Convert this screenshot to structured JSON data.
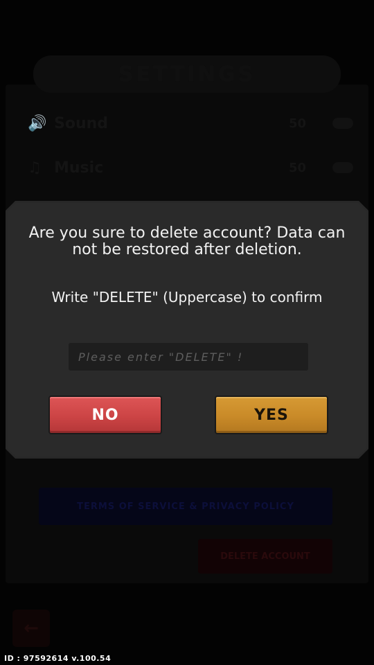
{
  "background": {
    "title": "SETTINGS",
    "rows": [
      {
        "icon": "speaker-icon",
        "label": "Sound",
        "value": "50"
      },
      {
        "icon": "music-note-icon",
        "label": "Music",
        "value": "50"
      }
    ],
    "terms_label": "TERMS OF SERVICE & PRIVACY POLICY",
    "delete_label": "DELETE ACCOUNT"
  },
  "dialog": {
    "message": "Are you sure to delete account? Data can not be restored after deletion.",
    "instruction": "Write \"DELETE\" (Uppercase) to confirm",
    "input_value": "",
    "input_placeholder": "Please enter \"DELETE\" !",
    "no_label": "NO",
    "yes_label": "YES"
  },
  "footer": {
    "version": "ID : 97592614 v.100.54"
  },
  "colors": {
    "no_button": "#cc4445",
    "yes_button": "#c98a28",
    "modal": "#2a2a2a"
  }
}
